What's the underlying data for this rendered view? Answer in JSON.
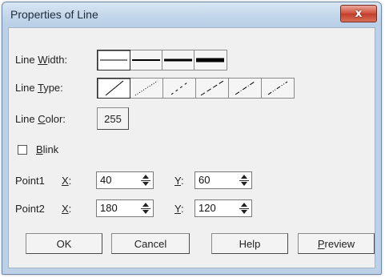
{
  "window": {
    "title": "Properties of Line",
    "close_glyph": "x"
  },
  "line_width": {
    "label_pre": "Line ",
    "label_key": "W",
    "label_post": "idth:",
    "options": [
      "thin",
      "medium",
      "thick",
      "extra-thick"
    ],
    "selected": 0
  },
  "line_type": {
    "label_pre": "Line ",
    "label_key": "T",
    "label_post": "ype:",
    "options": [
      "solid",
      "dotted",
      "dashed",
      "long-dash",
      "dash-dot",
      "dash-dot-dot"
    ],
    "selected": 0
  },
  "line_color": {
    "label_pre": "Line ",
    "label_key": "C",
    "label_post": "olor:",
    "value": "255"
  },
  "blink": {
    "label_key": "B",
    "label_post": "link",
    "checked": false
  },
  "point1": {
    "label": "Point1",
    "x_key": "X",
    "x_post": ":",
    "x_value": "40",
    "y_key": "Y",
    "y_post": ":",
    "y_value": "60"
  },
  "point2": {
    "label": "Point2",
    "x_key": "X",
    "x_post": ":",
    "x_value": "180",
    "y_key": "Y",
    "y_post": ":",
    "y_value": "120"
  },
  "buttons": {
    "ok": "OK",
    "cancel": "Cancel",
    "help": "Help",
    "preview_key": "P",
    "preview_post": "review"
  },
  "icons": {
    "close": "close-icon",
    "spin_up": "spin-up-icon",
    "spin_down": "spin-down-icon"
  }
}
